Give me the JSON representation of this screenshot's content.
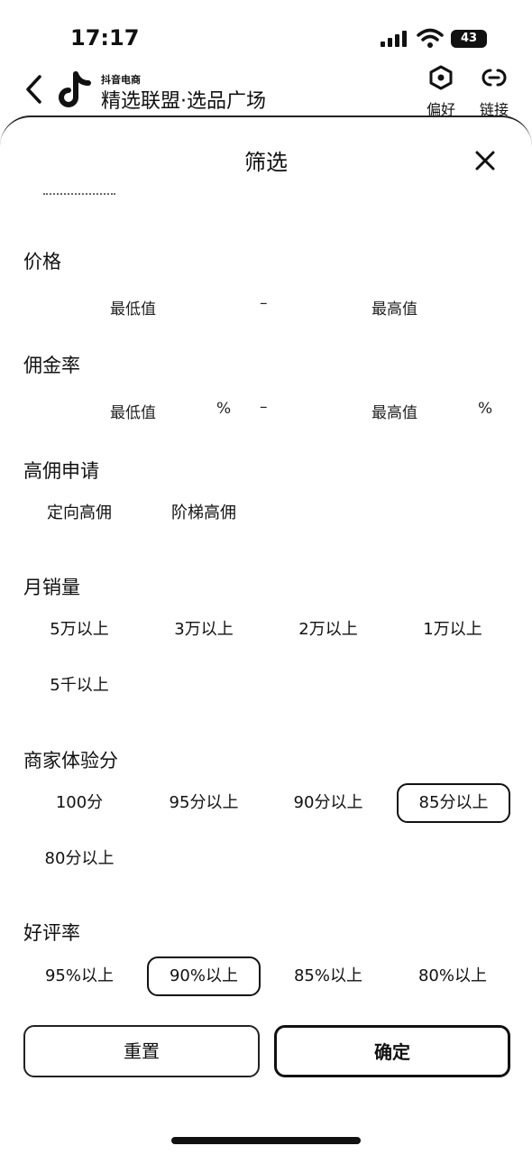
{
  "status_bar": {
    "time": "17:17",
    "battery": "43"
  },
  "header": {
    "brand_small": "抖音电商",
    "title": "精选联盟·选品广场",
    "preference_label": "偏好",
    "link_label": "链接"
  },
  "sheet": {
    "title": "筛选",
    "price": {
      "title": "价格",
      "min": "最低值",
      "dash": "–",
      "max": "最高值"
    },
    "commission": {
      "title": "佣金率",
      "min": "最低值",
      "min_unit": "%",
      "dash": "–",
      "max": "最高值",
      "max_unit": "%"
    },
    "high_commission": {
      "title": "高佣申请",
      "options": [
        "定向高佣",
        "阶梯高佣"
      ]
    },
    "monthly_sales": {
      "title": "月销量",
      "options": [
        "5万以上",
        "3万以上",
        "2万以上",
        "1万以上",
        "5千以上"
      ]
    },
    "merchant_score": {
      "title": "商家体验分",
      "options": [
        "100分",
        "95分以上",
        "90分以上",
        "85分以上",
        "80分以上"
      ],
      "selected": "85分以上"
    },
    "rating": {
      "title": "好评率",
      "options": [
        "95%以上",
        "90%以上",
        "85%以上",
        "80%以上"
      ],
      "selected": "90%以上"
    },
    "buttons": {
      "reset": "重置",
      "confirm": "确定"
    }
  }
}
